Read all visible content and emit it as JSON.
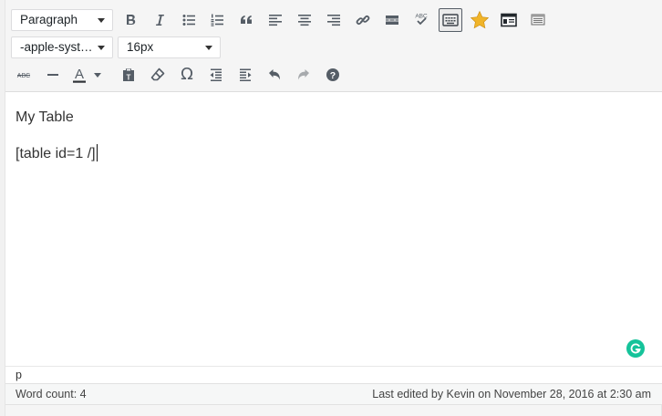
{
  "toolbar": {
    "format_select": {
      "value": "Paragraph"
    },
    "font_family_select": {
      "value": "-apple-syst…"
    },
    "font_size_select": {
      "value": "16px"
    },
    "row1_icons": [
      "bold-icon",
      "italic-icon",
      "bulleted-list-icon",
      "numbered-list-icon",
      "blockquote-icon",
      "align-left-icon",
      "align-center-icon",
      "align-right-icon",
      "link-icon",
      "read-more-icon",
      "spellcheck-icon",
      "toolbar-toggle-icon",
      "star-icon",
      "table-icon",
      "table-list-icon"
    ],
    "row3_icons": [
      "strikethrough-icon",
      "horizontal-line-icon",
      "text-color-icon",
      "paste-as-text-icon",
      "clear-formatting-icon",
      "special-character-icon",
      "outdent-icon",
      "indent-icon",
      "undo-icon",
      "redo-icon",
      "help-icon"
    ],
    "spellcheck_label": "ABC",
    "strikethrough_label": "ABC",
    "text_color_label": "A",
    "special_char_label": "Ω",
    "help_label": "?"
  },
  "content": {
    "line1": "My Table",
    "line2": "[table id=1 /]"
  },
  "path": {
    "value": "p"
  },
  "status": {
    "word_count": "Word count: 4",
    "last_edited": "Last edited by Kevin on November 28, 2016 at 2:30 am"
  },
  "colors": {
    "accent_star": "#f0b429",
    "grammarly": "#15c39a",
    "icon": "#555d66",
    "disabled": "#a7aaad"
  }
}
